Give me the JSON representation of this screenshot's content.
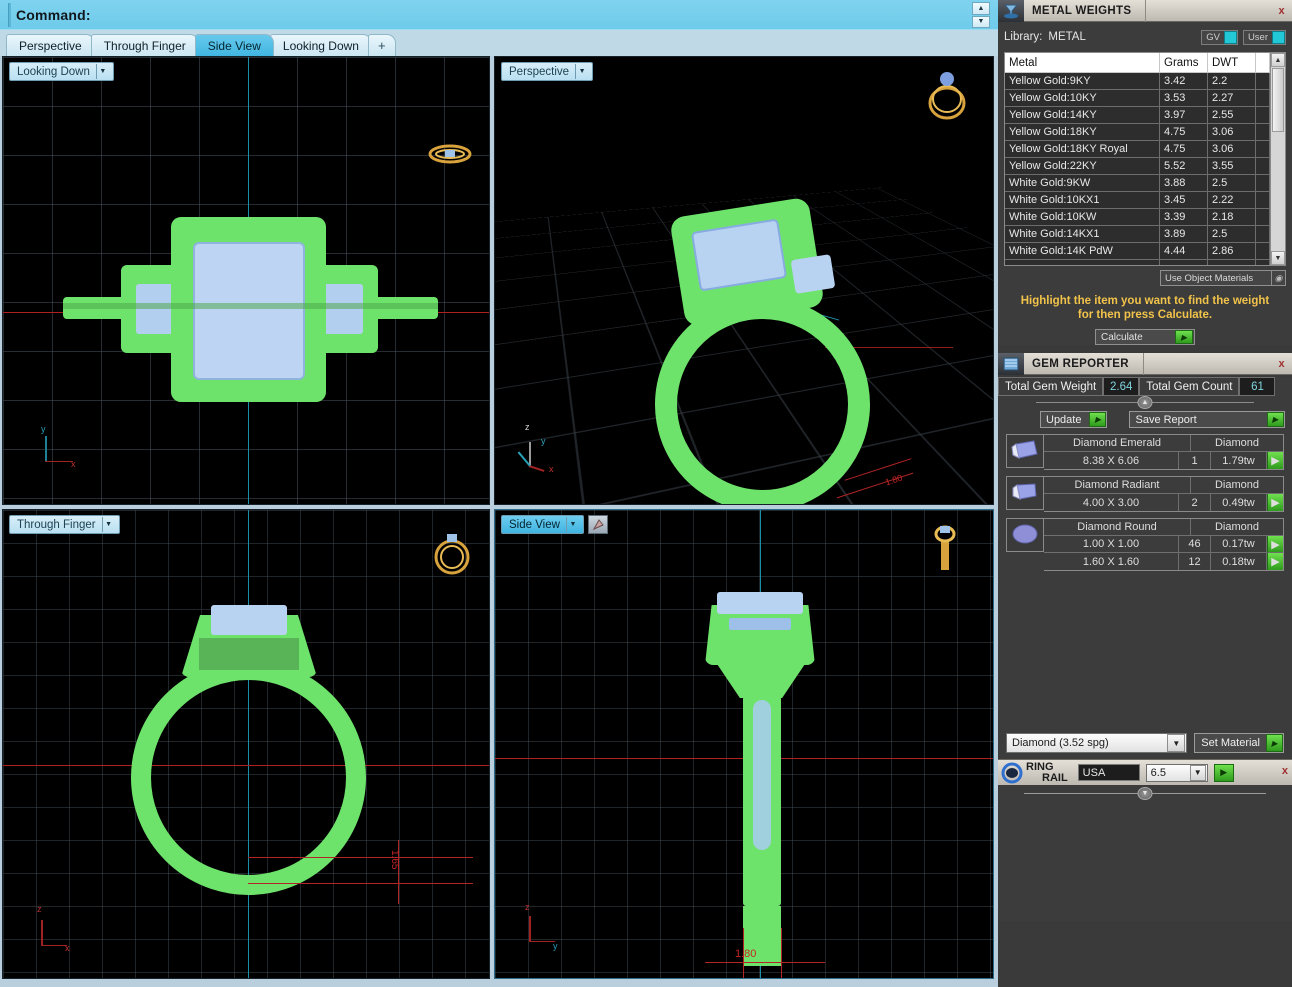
{
  "command_bar": {
    "label": "Command:",
    "value": ""
  },
  "view_tabs": [
    {
      "label": "Perspective",
      "active": false
    },
    {
      "label": "Through Finger",
      "active": false
    },
    {
      "label": "Side View",
      "active": true
    },
    {
      "label": "Looking Down",
      "active": false
    },
    {
      "label": "+",
      "active": false
    }
  ],
  "viewports": [
    {
      "name": "looking-down",
      "label": "Looking Down",
      "active": false,
      "axes": [
        "y",
        "x"
      ]
    },
    {
      "name": "perspective",
      "label": "Perspective",
      "active": false,
      "axes": [
        "z",
        "y",
        "x"
      ],
      "dim": "1.80"
    },
    {
      "name": "through-finger",
      "label": "Through Finger",
      "active": false,
      "axes": [
        "z",
        "x"
      ],
      "dim": "1.65"
    },
    {
      "name": "side-view",
      "label": "Side View",
      "active": true,
      "axes": [
        "z",
        "y"
      ],
      "dim": "1.80"
    }
  ],
  "metal_weights": {
    "title": "METAL WEIGHTS",
    "close_label": "x",
    "library_label": "Library:",
    "library_value": "METAL",
    "toggles": [
      {
        "label": "GV",
        "on": true
      },
      {
        "label": "User",
        "on": true
      }
    ],
    "columns": [
      "Metal",
      "Grams",
      "DWT"
    ],
    "rows": [
      {
        "metal": "Yellow Gold:9KY",
        "grams": "3.42",
        "dwt": "2.2"
      },
      {
        "metal": "Yellow Gold:10KY",
        "grams": "3.53",
        "dwt": "2.27"
      },
      {
        "metal": "Yellow Gold:14KY",
        "grams": "3.97",
        "dwt": "2.55"
      },
      {
        "metal": "Yellow Gold:18KY",
        "grams": "4.75",
        "dwt": "3.06"
      },
      {
        "metal": "Yellow Gold:18KY Royal",
        "grams": "4.75",
        "dwt": "3.06"
      },
      {
        "metal": "Yellow Gold:22KY",
        "grams": "5.52",
        "dwt": "3.55"
      },
      {
        "metal": "White Gold:9KW",
        "grams": "3.88",
        "dwt": "2.5"
      },
      {
        "metal": "White Gold:10KX1",
        "grams": "3.45",
        "dwt": "2.22"
      },
      {
        "metal": "White Gold:10KW",
        "grams": "3.39",
        "dwt": "2.18"
      },
      {
        "metal": "White Gold:14KX1",
        "grams": "3.89",
        "dwt": "2.5"
      },
      {
        "metal": "White Gold:14K PdW",
        "grams": "4.44",
        "dwt": "2.86"
      }
    ],
    "use_object_materials": "Use Object Materials",
    "hint_line1": "Highlight the item you want to find the weight",
    "hint_line2": "for then press Calculate.",
    "calculate_label": "Calculate"
  },
  "gem_reporter": {
    "title": "GEM REPORTER",
    "close_label": "x",
    "total_weight_label": "Total Gem Weight",
    "total_weight_value": "2.64",
    "total_count_label": "Total Gem Count",
    "total_count_value": "61",
    "update_label": "Update",
    "save_report_label": "Save Report",
    "groups": [
      {
        "icon": "gem-emerald-icon",
        "name": "Diamond Emerald",
        "material": "Diamond",
        "rows": [
          {
            "size": "8.38 X 6.06",
            "count": "1",
            "tw": "1.79tw"
          }
        ]
      },
      {
        "icon": "gem-radiant-icon",
        "name": "Diamond Radiant",
        "material": "Diamond",
        "rows": [
          {
            "size": "4.00 X 3.00",
            "count": "2",
            "tw": "0.49tw"
          }
        ]
      },
      {
        "icon": "gem-round-icon",
        "name": "Diamond Round",
        "material": "Diamond",
        "rows": [
          {
            "size": "1.00 X 1.00",
            "count": "46",
            "tw": "0.17tw"
          },
          {
            "size": "1.60 X 1.60",
            "count": "12",
            "tw": "0.18tw"
          }
        ]
      }
    ]
  },
  "material_bar": {
    "selected": "Diamond    (3.52 spg)",
    "set_material_label": "Set Material"
  },
  "ring_rail": {
    "title_line1": "RING",
    "title_line2": "RAIL",
    "region_value": "USA",
    "size_value": "6.5",
    "close_label": "x"
  },
  "colors": {
    "accent_cyan": "#41b6e2",
    "metal_green": "#6ee36b",
    "gem_blue": "#aecdf0",
    "hint_yellow": "#f2c34a",
    "go_green": "#2f9b1d",
    "dim_red": "#c62626",
    "panel_bg": "#3c3c3c"
  }
}
